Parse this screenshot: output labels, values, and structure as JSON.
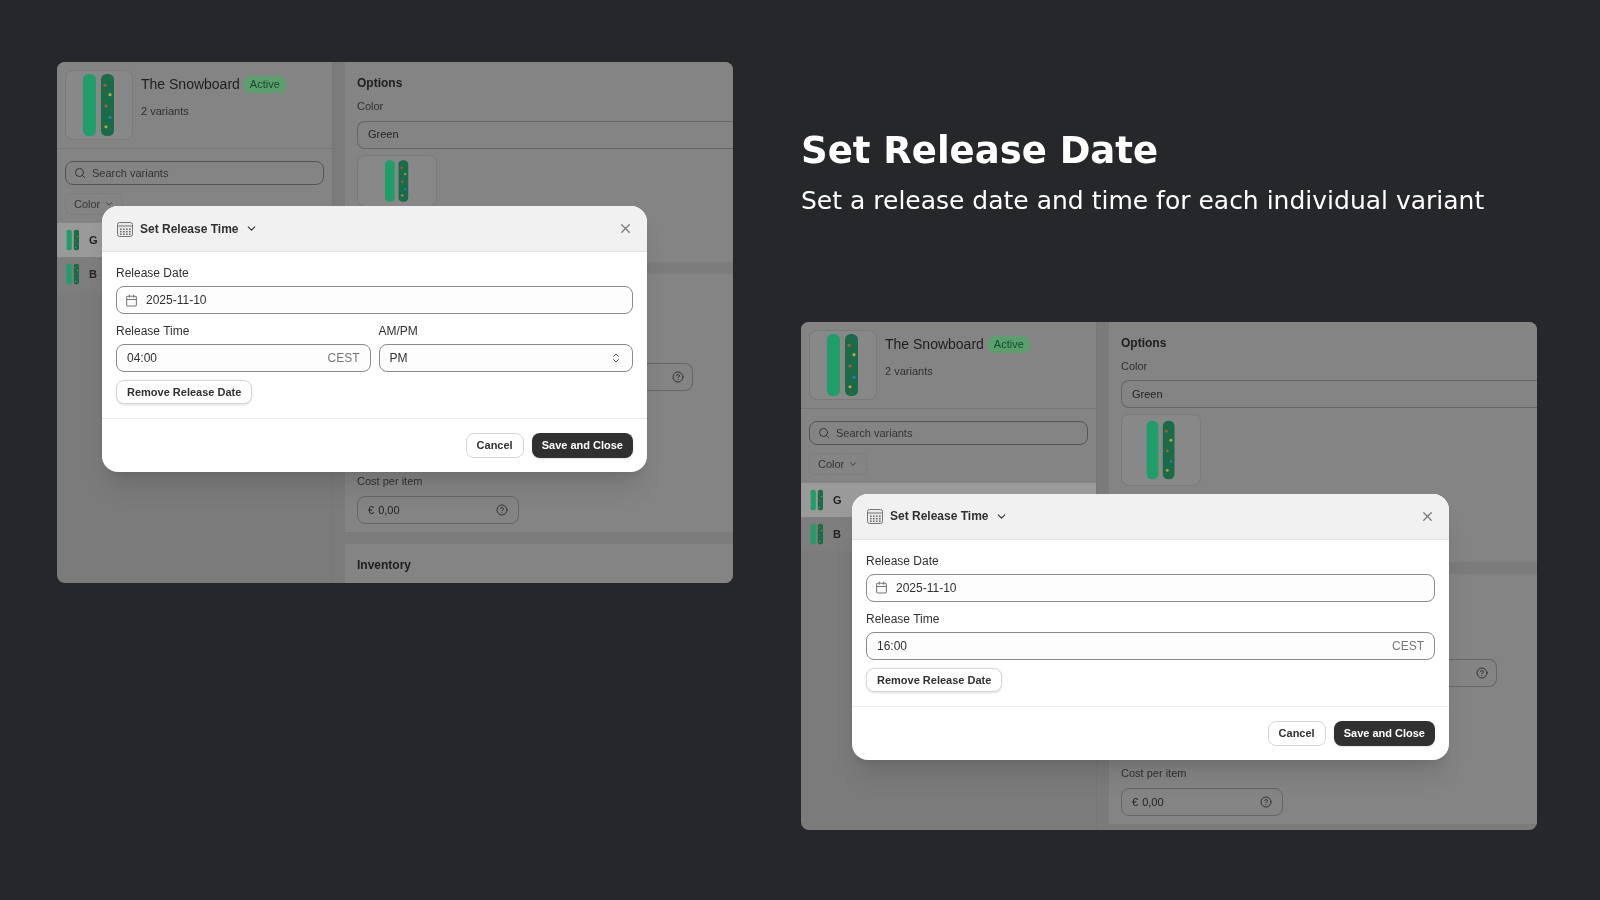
{
  "headline": {
    "title": "Set Release Date",
    "subtitle": "Set a release date and time for each individual variant"
  },
  "screenshots": [
    {
      "product": {
        "title": "The Snowboard",
        "status": "Active",
        "variants": "2 variants"
      },
      "search": {
        "placeholder": "Search variants"
      },
      "filter": "Color",
      "variant_rows": [
        {
          "label": "G",
          "selected": true
        },
        {
          "label": "B",
          "selected": false
        }
      ],
      "options": {
        "heading": "Options",
        "label": "Color",
        "value": "Green"
      },
      "cost": {
        "label": "Cost per item",
        "currency": "€",
        "value": "0,00"
      },
      "inventory_heading": "Inventory",
      "modal": {
        "title": "Set Release Time",
        "fields": [
          {
            "kind": "date",
            "label": "Release Date",
            "value": "2025-11-10"
          },
          {
            "kind": "time",
            "label": "Release Time",
            "value": "04:00",
            "suffix": "CEST"
          },
          {
            "kind": "select",
            "label": "AM/PM",
            "value": "PM"
          }
        ],
        "remove_button": "Remove Release Date",
        "buttons": [
          "Cancel",
          "Save and Close"
        ]
      }
    },
    {
      "product": {
        "title": "The Snowboard",
        "status": "Active",
        "variants": "2 variants"
      },
      "search": {
        "placeholder": "Search variants"
      },
      "filter": "Color",
      "variant_rows": [
        {
          "label": "G",
          "selected": true
        },
        {
          "label": "B",
          "selected": false
        }
      ],
      "options": {
        "heading": "Options",
        "label": "Color",
        "value": "Green"
      },
      "cost": {
        "label": "Cost per item",
        "currency": "€",
        "value": "0,00"
      },
      "modal": {
        "title": "Set Release Time",
        "fields": [
          {
            "kind": "date",
            "label": "Release Date",
            "value": "2025-11-10"
          },
          {
            "kind": "time",
            "label": "Release Time",
            "value": "16:00",
            "suffix": "CEST"
          }
        ],
        "remove_button": "Remove Release Date",
        "buttons": [
          "Cancel",
          "Save and Close"
        ]
      }
    }
  ]
}
